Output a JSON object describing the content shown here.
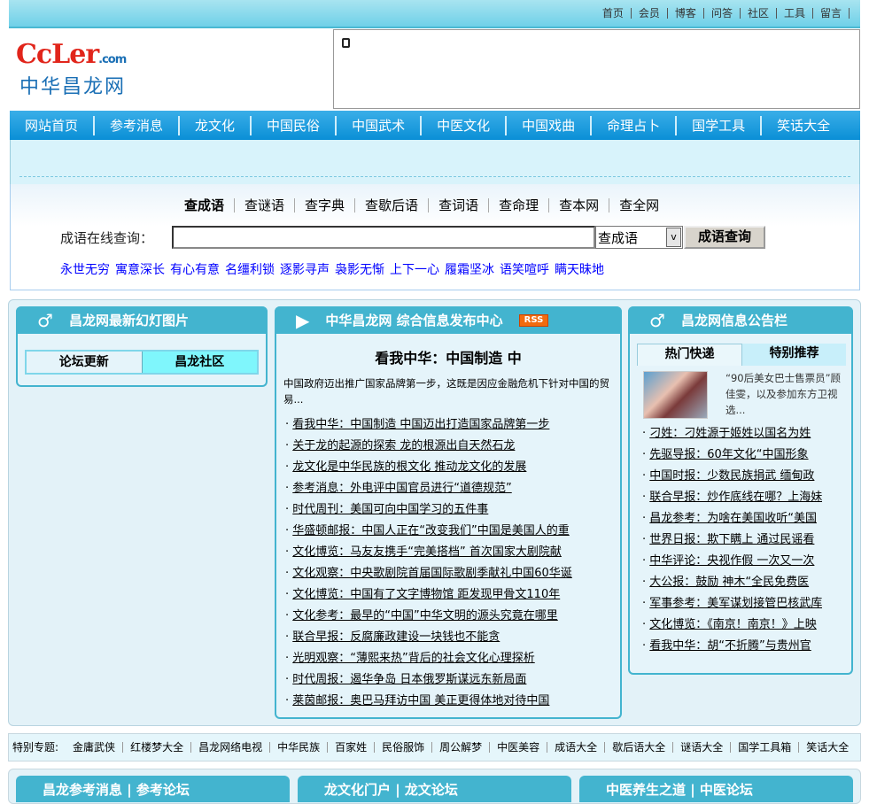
{
  "top_links": [
    "首页",
    "会员",
    "博客",
    "问答",
    "社区",
    "工具",
    "留言"
  ],
  "logo": {
    "en": "CcLer",
    "com": ".com",
    "cn": "中华昌龙网"
  },
  "nav": [
    "网站首页",
    "参考消息",
    "龙文化",
    "中国民俗",
    "中国武术",
    "中医文化",
    "中国戏曲",
    "命理占卜",
    "国学工具",
    "笑话大全"
  ],
  "search": {
    "tabs": [
      "查成语",
      "查谜语",
      "查字典",
      "查歇后语",
      "查词语",
      "查命理",
      "查本网",
      "查全网"
    ],
    "label": "成语在线查询：",
    "input_value": "",
    "select_value": "查成语",
    "button": "成语查询",
    "words": [
      "永世无穷",
      "寓意深长",
      "有心有意",
      "名缰利锁",
      "逐影寻声",
      "袅影无惭",
      "上下一心",
      "履霜坚冰",
      "语笑喧呼",
      "瞒天昧地"
    ]
  },
  "panel_left": {
    "title": "昌龙网最新幻灯图片",
    "tabs": [
      "论坛更新",
      "昌龙社区"
    ]
  },
  "panel_center": {
    "title": "中华昌龙网 综合信息发布中心",
    "rss": "RSS",
    "headline": "看我中华：中国制造 中",
    "summary": "中国政府迈出推广国家品牌第一步，这既是因应金融危机下针对中国的贸易...",
    "items": [
      "看我中华：中国制造 中国迈出打造国家品牌第一步",
      "关于龙的起源的探索 龙的根源出自天然石龙",
      "龙文化是中华民族的根文化 推动龙文化的发展",
      "参考消息：外电评中国官员进行“道德规范”",
      "时代周刊：美国可向中国学习的五件事",
      "华盛顿邮报：中国人正在“改变我们”中国是美国人的重",
      "文化博览：马友友携手“完美搭档” 首次国家大剧院献",
      "文化观察：中央歌剧院首届国际歌剧季献礼中国60华诞",
      "文化博览：中国有了文字博物馆 距发现甲骨文110年",
      "文化参考：最早的“中国”中华文明的源头究竟在哪里",
      "联合早报：反腐廉政建设一块钱也不能贪",
      "光明观察：“薄熙来热”背后的社会文化心理探析",
      "时代周报：遏华争岛 日本俄罗斯谋远东新局面",
      "莱茵邮报：奥巴马拜访中国 美正更得体地对待中国"
    ]
  },
  "panel_right": {
    "title": "昌龙网信息公告栏",
    "tabs": [
      "热门快递",
      "特别推荐"
    ],
    "photo_summary": "“90后美女巴士售票员”顾佳雯，以及参加东方卫视选...",
    "items": [
      "刁姓：刁姓源于姬姓以国名为姓",
      "先驱导报：60年文化“中国形象",
      "中国时报：少数民族捐武 缅甸政",
      "联合早报：炒作底线在哪？上海妹",
      "昌龙参考：为啥在美国收听“美国",
      "世界日报：欺下瞒上 通过民谣看",
      "中华评论：央视作假 一次又一次",
      "大公报：鼓励 神木“全民免费医",
      "军事参考：美军谋划接管巴核武库",
      "文化博览：《南京！南京！》上映",
      "看我中华：胡“不折腾”与贵州官"
    ]
  },
  "special": {
    "label": "特别专题:",
    "items": [
      "金庸武侠",
      "红楼梦大全",
      "昌龙网络电视",
      "中华民族",
      "百家姓",
      "民俗服饰",
      "周公解梦",
      "中医美容",
      "成语大全",
      "歇后语大全",
      "谜语大全",
      "国学工具箱",
      "笑话大全"
    ]
  },
  "bottom_panels": [
    "昌龙参考消息 | 参考论坛",
    "龙文化门户 | 龙文论坛",
    "中医养生之道 | 中医论坛"
  ]
}
